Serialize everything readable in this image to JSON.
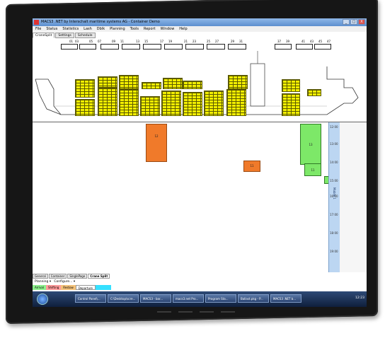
{
  "window": {
    "title": "MACS3 .NET by Interschalt maritime systems AG - Container Demo",
    "buttons": [
      "_",
      "□",
      "X"
    ]
  },
  "menu": [
    "File",
    "Status",
    "Statistics",
    "Lash",
    "Dblk",
    "Planning",
    "Tools",
    "Report",
    "Window",
    "Help"
  ],
  "tabs": [
    "CraneSplit",
    "Settings",
    "Schedule"
  ],
  "bay_numbers": [
    "01",
    "02",
    "03",
    "05",
    "06",
    "07",
    "09",
    "10",
    "11",
    "13",
    "14",
    "15",
    "17",
    "18",
    "19",
    "21",
    "22",
    "23",
    "25",
    "26",
    "27",
    "29",
    "30",
    "31",
    "33",
    "34",
    "35",
    "37",
    "38",
    "39",
    "41",
    "42",
    "43",
    "45",
    "46",
    "47"
  ],
  "gantt_tasks": [
    "12",
    "11",
    "13",
    "11",
    "9"
  ],
  "time_ticks": [
    "12:00",
    "13:00",
    "14:00",
    "15:00",
    "16:00",
    "17:00",
    "18:00",
    "19:00"
  ],
  "time_axis_label": "Mobile 1",
  "bottom_tabs": [
    "General",
    "Container",
    "SinglePage",
    "Crane Split"
  ],
  "plan_bar": [
    "Planning ▾",
    "Configure... ▾"
  ],
  "legend": [
    {
      "label": "Arrival",
      "color": "#8ef08e"
    },
    {
      "label": "Shifting",
      "color": "#ff9b9b"
    },
    {
      "label": "Restow",
      "color": "#f3c27a"
    },
    {
      "label": "Departure",
      "color": "#ffffff"
    },
    {
      "label": "",
      "color": "#35e0ff"
    }
  ],
  "taskbar_items": [
    "Control Panel\\...",
    "C:\\Desktop\\scre...",
    "MACS3 - bar...",
    "macs3.net Pro...",
    "Program Sta...",
    "Ballast.pkg - P...",
    "MACS3 .NET b..."
  ],
  "clock": "12:23",
  "colors": {
    "orange": "#f07a2a",
    "green": "#7de868",
    "yellow": "#f4f000",
    "axis_blue": "#bcd6f2"
  }
}
